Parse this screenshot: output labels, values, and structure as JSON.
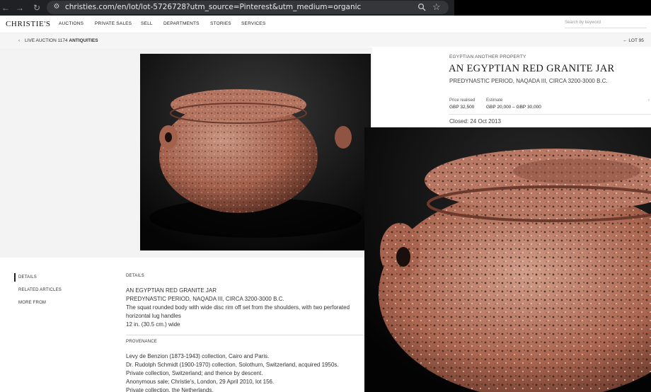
{
  "browser": {
    "url": "christies.com/en/lot/lot-5726728?utm_source=Pinterest&utm_medium=organic",
    "icons": [
      "back-icon",
      "forward-icon",
      "reload-icon",
      "site-settings-icon",
      "zoom-icon",
      "bookmark-star-icon"
    ]
  },
  "header": {
    "logo": "CHRISTIE'S",
    "nav": [
      "AUCTIONS",
      "PRIVATE SALES",
      "SELL",
      "DEPARTMENTS",
      "STORIES",
      "SERVICES"
    ],
    "search_placeholder": "Search by keyword"
  },
  "breadcrumb": {
    "prefix": "LIVE AUCTION 1174",
    "sale": "ANTIQUITIES",
    "lot_nav": "LOT 95"
  },
  "lot": {
    "department": "EGYPTIAN ANOTHER PROPERTY",
    "title": "AN EGYPTIAN RED GRANITE JAR",
    "subtitle": "PREDYNASTIC PERIOD, NAQADA III, CIRCA 3200-3000 B.C.",
    "price_label": "Price realised",
    "price_value": "GBP 32,500",
    "estimate_label": "Estimate",
    "estimate_value": "GBP 20,000 – GBP 30,000",
    "closed": "Closed: 24 Oct 2013"
  },
  "sidenav": {
    "items": [
      "DETAILS",
      "RELATED ARTICLES",
      "MORE FROM"
    ],
    "active": "DETAILS"
  },
  "details": {
    "heading": "DETAILS",
    "lines": [
      "AN EGYPTIAN RED GRANITE JAR",
      "PREDYNASTIC PERIOD, NAQADA III, CIRCA 3200-3000 B.C.",
      "The squat rounded body with wide disc rim off set from the shoulders, with two perforated",
      "horizontal lug handles",
      "12 in. (30.5 cm.) wide"
    ]
  },
  "provenance": {
    "heading": "PROVENANCE",
    "lines": [
      "Levy de Benzion (1873-1943) collection, Cairo and Paris.",
      "Dr. Rudolph Schmidt (1900-1970) collection, Solothurn, Switzerland, acquired 1950s.",
      "Private collection, Switzerland; and thence by descent.",
      "Anonymous sale; Christie's, London, 29 April 2010, lot 156.",
      "Private collection, the Netherlands."
    ]
  },
  "colors": {
    "browser_bar": "#202124",
    "omnibox": "#35363a",
    "granite_base": "#b06a55",
    "photo_background": "#0b0b0b",
    "gallery_background": "#f3f3f3"
  }
}
